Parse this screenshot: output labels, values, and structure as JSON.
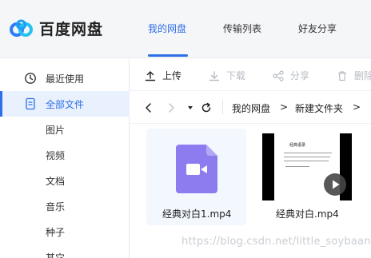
{
  "app": {
    "name": "百度网盘"
  },
  "header": {
    "tabs": [
      {
        "label": "我的网盘",
        "active": true
      },
      {
        "label": "传输列表",
        "active": false
      },
      {
        "label": "好友分享",
        "active": false
      }
    ]
  },
  "sidebar": {
    "items": [
      {
        "label": "最近使用",
        "icon": "clock-icon",
        "active": false
      },
      {
        "label": "全部文件",
        "icon": "document-icon",
        "active": true
      },
      {
        "label": "图片",
        "active": false
      },
      {
        "label": "视频",
        "active": false
      },
      {
        "label": "文档",
        "active": false
      },
      {
        "label": "音乐",
        "active": false
      },
      {
        "label": "种子",
        "active": false
      },
      {
        "label": "其它",
        "active": false
      }
    ]
  },
  "toolbar": {
    "upload": "上传",
    "download": "下载",
    "share": "分享",
    "delete": "删除"
  },
  "pathbar": {
    "crumbs": [
      "我的网盘",
      "新建文件夹"
    ],
    "separator": ">"
  },
  "files": [
    {
      "name": "经典对白1.mp4",
      "type": "video-doc",
      "selected": true
    },
    {
      "name": "经典对白.mp4",
      "type": "video-thumbnail",
      "thumb_title": "经典语录"
    }
  ],
  "watermark": "https://blog.csdn.net/little_soybaan",
  "colors": {
    "accent": "#2e6ee6",
    "video_doc": "#8c7cf0",
    "selected_card": "#f3f8ff"
  }
}
